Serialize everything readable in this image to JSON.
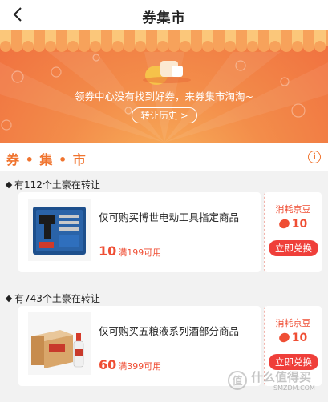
{
  "nav": {
    "title": "券集市"
  },
  "banner": {
    "message": "领券中心没有找到好券，来券集市淘淘~",
    "button_label": "转让历史 >",
    "colors": {
      "top": "#f06f3f",
      "glow": "#f8b25c"
    }
  },
  "section": {
    "title": "券 • 集 • 市",
    "info_icon": "info-icon"
  },
  "groups": [
    {
      "label": "有112个土豪在转让",
      "coupon": {
        "desc": "仅可购买博世电动工具指定商品",
        "amount": "10",
        "condition": "满199可用",
        "cost_label": "消耗京豆",
        "cost": "10",
        "button": "立即兑换",
        "image": "power-tool-kit-image"
      }
    },
    {
      "label": "有743个土豪在转让",
      "coupon": {
        "desc": "仅可购买五粮液系列酒部分商品",
        "amount": "60",
        "condition": "满399可用",
        "cost_label": "消耗京豆",
        "cost": "10",
        "button": "立即兑换",
        "image": "liquor-box-image"
      }
    }
  ],
  "watermark": {
    "text": "什么值得买",
    "small": "SMZDM.COM"
  },
  "colors": {
    "accent": "#f0742f",
    "price": "#ef4e34",
    "button": "#ef3f3a"
  }
}
